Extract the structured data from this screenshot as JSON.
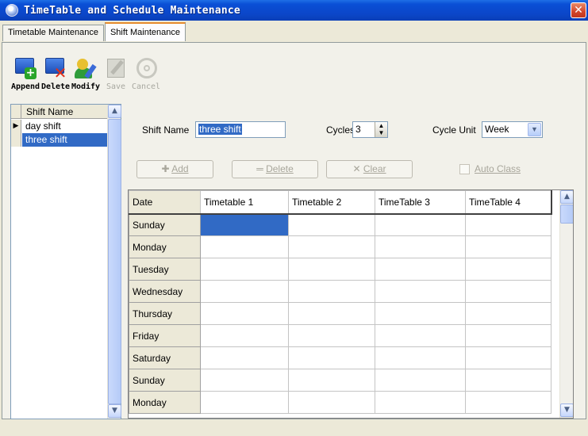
{
  "window": {
    "title": "TimeTable and Schedule Maintenance",
    "close_glyph": "✕"
  },
  "tabs": [
    {
      "label": "Timetable Maintenance",
      "active": false
    },
    {
      "label": "Shift Maintenance",
      "active": true
    }
  ],
  "toolbar": {
    "append": {
      "label": "Append",
      "icon": "append-icon",
      "enabled": true
    },
    "delete": {
      "label": "Delete",
      "icon": "delete-icon",
      "enabled": true
    },
    "modify": {
      "label": "Modify",
      "icon": "modify-icon",
      "enabled": true
    },
    "save": {
      "label": "Save",
      "icon": "save-icon",
      "enabled": false
    },
    "cancel": {
      "label": "Cancel",
      "icon": "cancel-icon",
      "enabled": false
    }
  },
  "shift_list": {
    "header": "Shift Name",
    "items": [
      {
        "name": "day shift",
        "current": true,
        "selected": false
      },
      {
        "name": "three shift",
        "current": false,
        "selected": true
      }
    ]
  },
  "form": {
    "shift_name_label": "Shift Name",
    "shift_name_value": "three shift",
    "cycles_label": "Cycles",
    "cycles_value": "3",
    "cycle_unit_label": "Cycle Unit",
    "cycle_unit_value": "Week",
    "add_label": "Add",
    "delete_label": "Delete",
    "clear_label": "Clear",
    "auto_class_label": "Auto Class"
  },
  "grid": {
    "columns": [
      "Date",
      "Timetable 1",
      "Timetable 2",
      "TimeTable 3",
      "TimeTable 4"
    ],
    "rows": [
      "Sunday",
      "Monday",
      "Tuesday",
      "Wednesday",
      "Thursday",
      "Friday",
      "Saturday",
      "Sunday",
      "Monday"
    ]
  },
  "colors": {
    "titlebar": "#0b46c8",
    "selection": "#316ac5",
    "active_tab_accent": "#e68b2c"
  }
}
